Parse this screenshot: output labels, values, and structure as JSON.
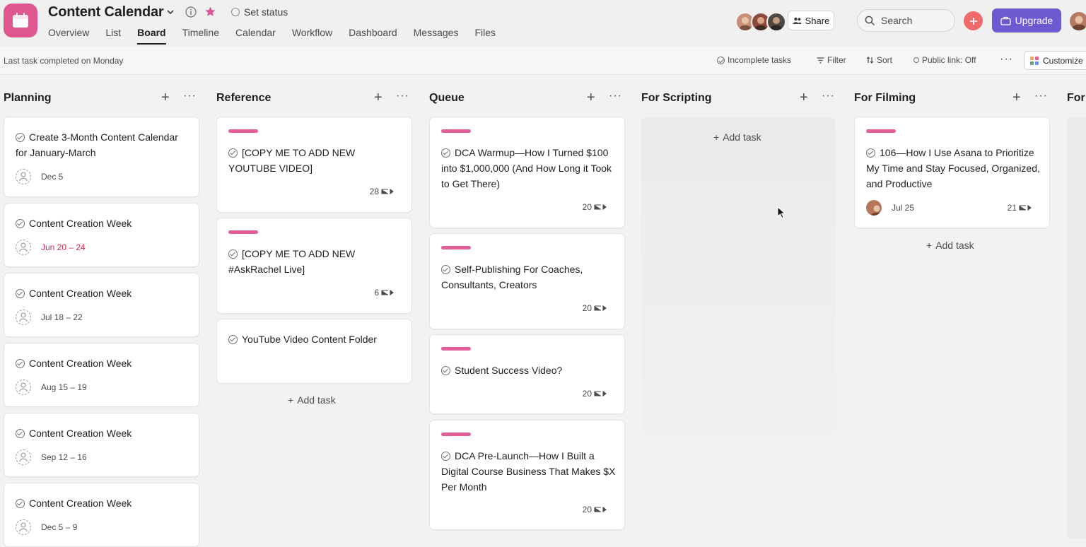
{
  "header": {
    "project_title": "Content Calendar",
    "set_status": "Set status",
    "tabs": [
      {
        "label": "Overview",
        "active": false
      },
      {
        "label": "List",
        "active": false
      },
      {
        "label": "Board",
        "active": true
      },
      {
        "label": "Timeline",
        "active": false
      },
      {
        "label": "Calendar",
        "active": false
      },
      {
        "label": "Workflow",
        "active": false
      },
      {
        "label": "Dashboard",
        "active": false
      },
      {
        "label": "Messages",
        "active": false
      },
      {
        "label": "Files",
        "active": false
      }
    ],
    "share_label": "Share",
    "search_placeholder": "Search",
    "upgrade_label": "Upgrade",
    "icons": [
      "calendar-icon",
      "chevron-down-icon",
      "info-icon",
      "star-icon",
      "people-icon",
      "search-icon",
      "plus-icon",
      "briefcase-icon"
    ]
  },
  "subbar": {
    "last_task": "Last task completed on Monday",
    "incomplete": "Incomplete tasks",
    "filter": "Filter",
    "sort": "Sort",
    "public_link": "Public link: Off",
    "customize": "Customize"
  },
  "columns": [
    {
      "name": "Planning",
      "cards": [
        {
          "title": "Create 3-Month Content Calendar for January-March",
          "date": "Dec 5",
          "overdue": false
        },
        {
          "title": "Content Creation Week",
          "date": "Jun 20 – 24",
          "overdue": true
        },
        {
          "title": "Content Creation Week",
          "date": "Jul 18 – 22",
          "overdue": false
        },
        {
          "title": "Content Creation Week",
          "date": "Aug 15 – 19",
          "overdue": false
        },
        {
          "title": "Content Creation Week",
          "date": "Sep 12 – 16",
          "overdue": false
        },
        {
          "title": "Content Creation Week",
          "date": "Dec 5 – 9",
          "overdue": false
        }
      ]
    },
    {
      "name": "Reference",
      "cards": [
        {
          "title": "[COPY ME TO ADD NEW YOUTUBE VIDEO]",
          "subtasks": "28"
        },
        {
          "title": "[COPY ME TO ADD NEW #AskRachel Live]",
          "subtasks": "6"
        },
        {
          "title": "YouTube Video Content Folder"
        }
      ],
      "add_task": "Add task"
    },
    {
      "name": "Queue",
      "cards": [
        {
          "title": "DCA Warmup—How I Turned $100 into $1,000,000 (And How Long it Took to Get There)",
          "subtasks": "20"
        },
        {
          "title": "Self-Publishing For Coaches, Consultants, Creators",
          "subtasks": "20"
        },
        {
          "title": "Student Success Video?",
          "subtasks": "20"
        },
        {
          "title": "DCA Pre-Launch—How I Built a Digital Course Business That Makes $X Per Month",
          "subtasks": "20"
        }
      ]
    },
    {
      "name": "For Scripting",
      "add_task": "Add task"
    },
    {
      "name": "For Filming",
      "cards": [
        {
          "title": "106—How I Use Asana to Prioritize My Time and Stay Focused, Organized, and Productive",
          "date": "Jul 25",
          "subtasks": "21"
        }
      ],
      "add_task": "Add task"
    },
    {
      "name": "For"
    }
  ],
  "colors": {
    "brand_pink": "#e0568f",
    "tag_pink": "#e35d98",
    "overdue_red": "#c92f54",
    "upgrade_purple": "#6d5ad0",
    "add_red": "#f06a6a"
  }
}
